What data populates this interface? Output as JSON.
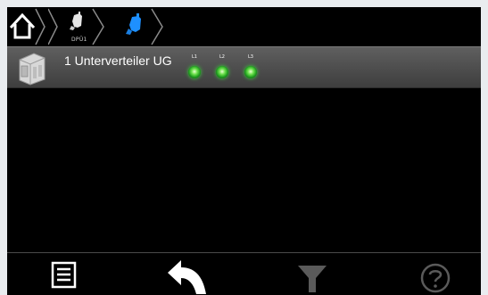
{
  "breadcrumb": {
    "items": [
      {
        "icon": "home-icon"
      },
      {
        "icon": "plug-icon",
        "label": "DPÜ1"
      },
      {
        "icon": "plug-icon-active"
      }
    ]
  },
  "devices": [
    {
      "icon": "distribution-board-icon",
      "title": "1 Unterverteiler UG",
      "phases": [
        {
          "label": "L1",
          "status": "ok",
          "color": "#3bd43b"
        },
        {
          "label": "L2",
          "status": "ok",
          "color": "#3bd43b"
        },
        {
          "label": "L3",
          "status": "ok",
          "color": "#3bd43b"
        }
      ]
    }
  ],
  "toolbar": {
    "buttons": [
      {
        "icon": "menu-list-icon",
        "enabled": true
      },
      {
        "icon": "back-arrow-icon",
        "enabled": true
      },
      {
        "icon": "filter-icon",
        "enabled": false
      },
      {
        "icon": "help-icon",
        "enabled": false
      }
    ]
  },
  "colors": {
    "background": "#000000",
    "row": "#4e4e4e",
    "active_accent": "#1e90ff",
    "disabled": "#5a5a5a",
    "led_ok": "#3bd43b"
  }
}
